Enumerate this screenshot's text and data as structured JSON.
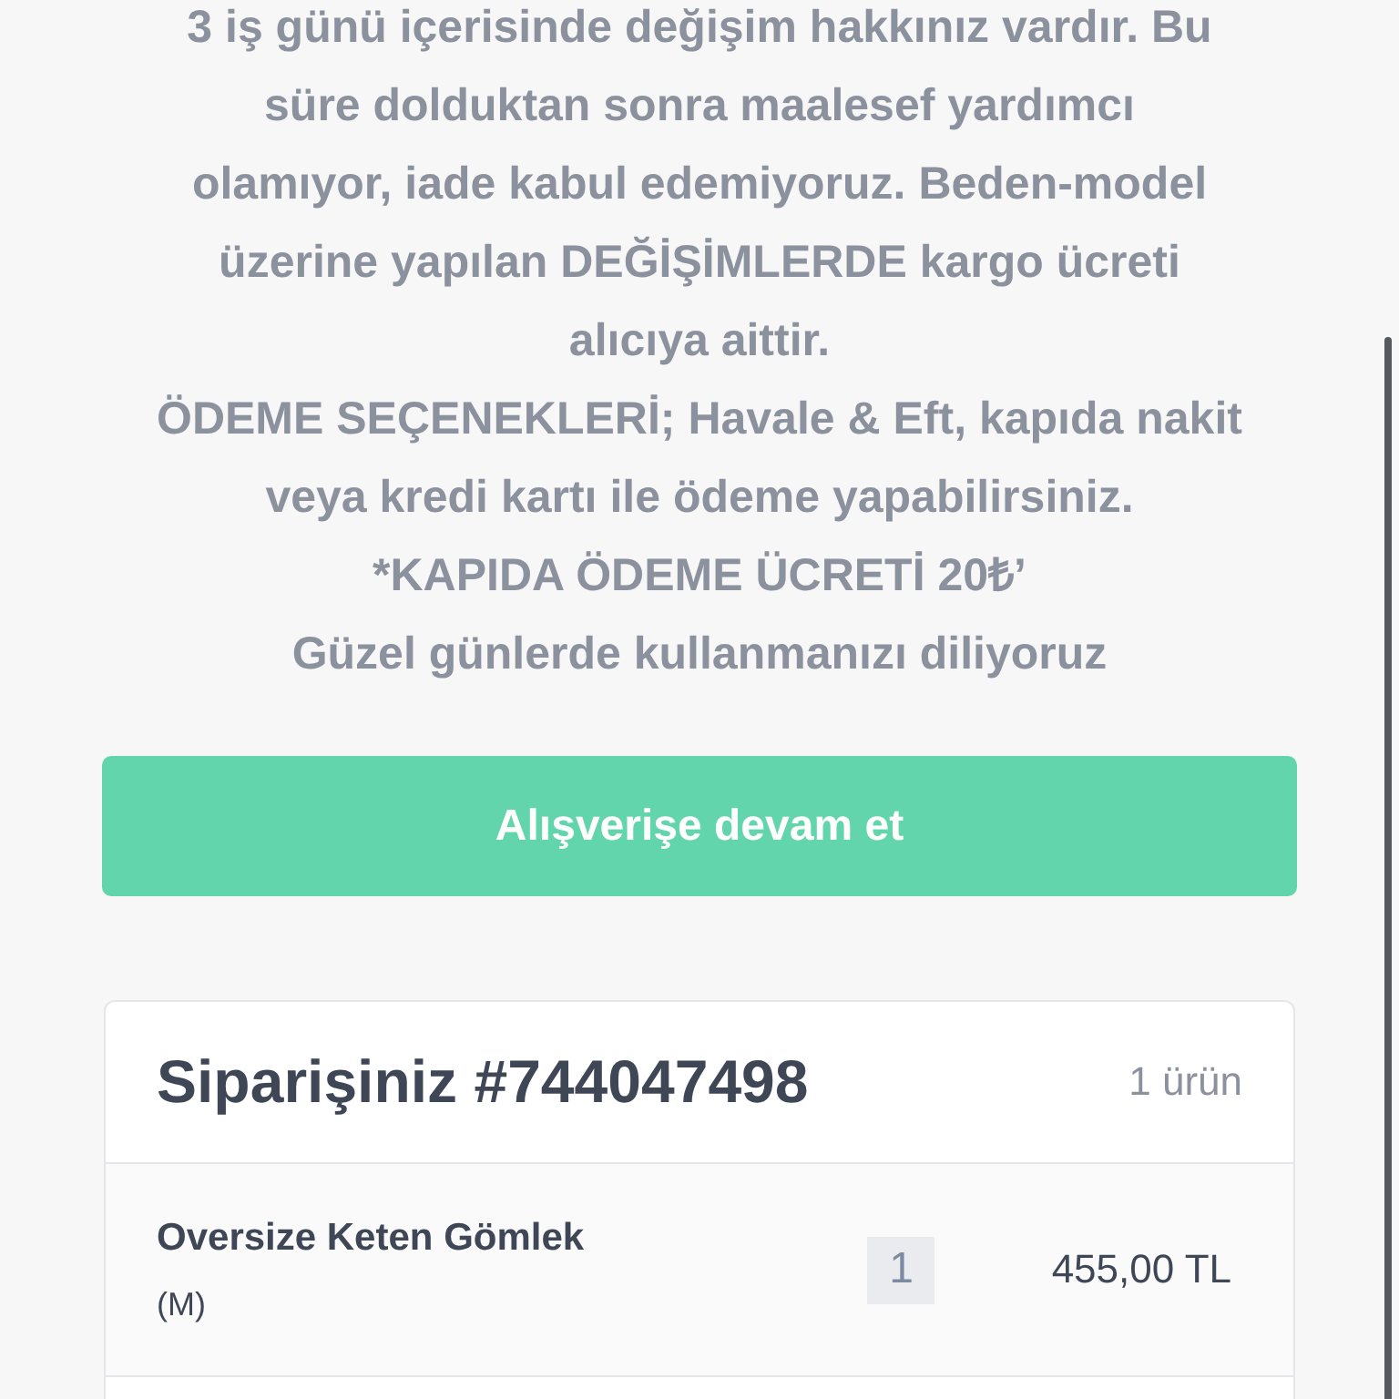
{
  "notice_lines": [
    "3 iş günü içerisinde değişim hakkınız vardır. Bu",
    "süre dolduktan sonra maalesef yardımcı",
    "olamıyor, iade kabul edemiyoruz. Beden-model",
    "üzerine yapılan DEĞİŞİMLERDE kargo ücreti",
    "alıcıya aittir.",
    "ÖDEME SEÇENEKLERİ; Havale & Eft, kapıda nakit",
    "veya kredi kartı ile ödeme yapabilirsiniz.",
    "*KAPIDA ÖDEME ÜCRETİ 20₺’",
    "Güzel günlerde kullanmanızı diliyoruz"
  ],
  "continue_button": "Alışverişe devam et",
  "order": {
    "title": "Siparişiniz #744047498",
    "item_count": "1 ürün",
    "items": [
      {
        "name": "Oversize Keten Gömlek",
        "variant": "(M)",
        "quantity": "1",
        "price": "455,00 TL"
      }
    ]
  }
}
